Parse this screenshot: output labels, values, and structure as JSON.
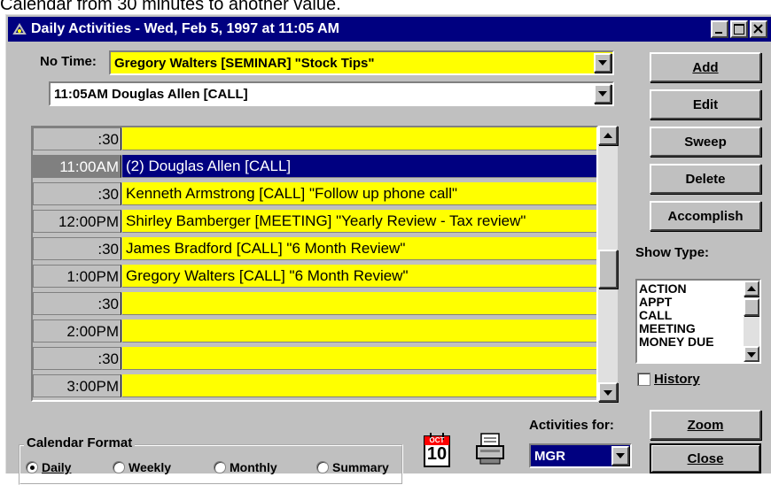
{
  "caption": "Calendar from 30 minutes to another value.",
  "window": {
    "title": "Daily Activities - Wed, Feb 5, 1997 at 11:05 AM"
  },
  "no_time": {
    "label": "No Time:",
    "value": "Gregory Walters [SEMINAR] \"Stock Tips\""
  },
  "current_activity": "11:05AM  Douglas Allen [CALL]",
  "schedule": [
    {
      "time": ":30",
      "entry": "",
      "selected": false
    },
    {
      "time": "11:00AM",
      "entry": "(2) Douglas Allen [CALL]",
      "selected": true
    },
    {
      "time": ":30",
      "entry": "Kenneth Armstrong [CALL] \"Follow up phone call\"",
      "selected": false
    },
    {
      "time": "12:00PM",
      "entry": "Shirley Bamberger [MEETING] \"Yearly Review - Tax review\"",
      "selected": false
    },
    {
      "time": ":30",
      "entry": "James Bradford [CALL] \"6 Month Review\"",
      "selected": false
    },
    {
      "time": "1:00PM",
      "entry": "Gregory Walters [CALL] \"6 Month Review\"",
      "selected": false
    },
    {
      "time": ":30",
      "entry": "",
      "selected": false
    },
    {
      "time": "2:00PM",
      "entry": "",
      "selected": false
    },
    {
      "time": ":30",
      "entry": "",
      "selected": false
    },
    {
      "time": "3:00PM",
      "entry": "",
      "selected": false
    }
  ],
  "buttons": {
    "add": "Add",
    "edit": "Edit",
    "sweep": "Sweep",
    "delete": "Delete",
    "accomplish": "Accomplish",
    "zoom": "Zoom",
    "close": "Close"
  },
  "show_type": {
    "label": "Show Type:",
    "items": [
      "ACTION",
      "APPT",
      "CALL",
      "MEETING",
      "MONEY DUE"
    ]
  },
  "history_label": "History",
  "calendar_format": {
    "label": "Calendar Format",
    "options": [
      "Daily",
      "Weekly",
      "Monthly",
      "Summary"
    ],
    "selected": "Daily"
  },
  "activities_for": {
    "label": "Activities for:",
    "value": "MGR"
  },
  "calendar_icon": {
    "month": "OCT",
    "day": "10"
  },
  "colors": {
    "titlebar": "#000080",
    "highlight": "#ffff00",
    "selection": "#000080",
    "face": "#c0c0c0"
  }
}
